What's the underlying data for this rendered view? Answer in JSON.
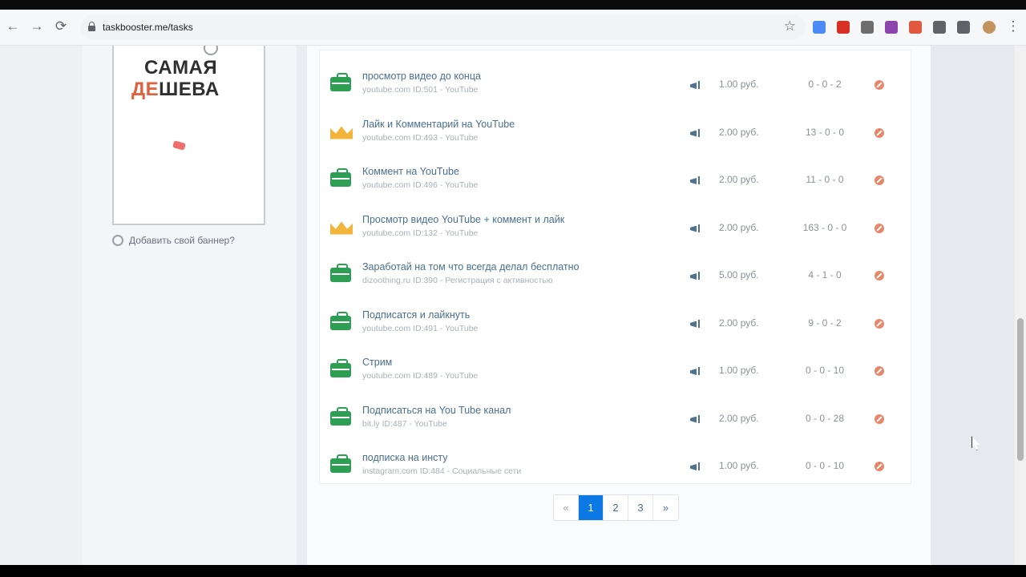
{
  "browser": {
    "url": "taskbooster.me/tasks",
    "back_glyph": "←",
    "forward_glyph": "→",
    "reload_glyph": "⟳",
    "star_glyph": "☆",
    "menu_glyph": "⋮",
    "extensions": [
      {
        "name": "ext-1-icon",
        "color": "#4c8bf5"
      },
      {
        "name": "ext-2-icon",
        "color": "#d93025"
      },
      {
        "name": "ext-3-icon",
        "color": "#6d6d6d"
      },
      {
        "name": "ext-4-icon",
        "color": "#8e44ad"
      },
      {
        "name": "ext-5-icon",
        "color": "#e2583e"
      },
      {
        "name": "ext-6-icon",
        "color": "#5f6368"
      },
      {
        "name": "extensions-puzzle-icon",
        "color": "#5f6368"
      },
      {
        "name": "profile-avatar-icon",
        "color": "#c2935f"
      }
    ]
  },
  "sidebar": {
    "banner_line1": "САМАЯ",
    "banner_line2_red": "ДЕ",
    "banner_line2_rest": "ШЕВА",
    "add_banner_label": "Добавить свой баннер?"
  },
  "tasks": [
    {
      "icon": "briefcase",
      "title": "просмотр видео до конца",
      "meta": "youtube.com ID:501 - YouTube",
      "price": "1.00 руб.",
      "counts": "0 - 0 - 2"
    },
    {
      "icon": "crown",
      "title": "Лайк и Комментарий на YouTube",
      "meta": "youtube.com ID:493 - YouTube",
      "price": "2.00 руб.",
      "counts": "13 - 0 - 0"
    },
    {
      "icon": "briefcase",
      "title": "Коммент на YouTube",
      "meta": "youtube.com ID:496 - YouTube",
      "price": "2.00 руб.",
      "counts": "11 - 0 - 0"
    },
    {
      "icon": "crown",
      "title": "Просмотр видео YouTube + коммент и лайк",
      "meta": "youtube.com ID:132 - YouTube",
      "price": "2.00 руб.",
      "counts": "163 - 0 - 0"
    },
    {
      "icon": "briefcase",
      "title": "Заработай на том что всегда делал бесплатно",
      "meta": "dizoothing.ru ID:390 - Регистрация с активностью",
      "price": "5.00 руб.",
      "counts": "4 - 1 - 0"
    },
    {
      "icon": "briefcase",
      "title": "Подписатся и лайкнуть",
      "meta": "youtube.com ID:491 - YouTube",
      "price": "2.00 руб.",
      "counts": "9 - 0 - 2"
    },
    {
      "icon": "briefcase",
      "title": "Стрим",
      "meta": "youtube.com ID:489 - YouTube",
      "price": "1.00 руб.",
      "counts": "0 - 0 - 10"
    },
    {
      "icon": "briefcase",
      "title": "Подписаться на You Tube канал",
      "meta": "bit.ly ID:487 - YouTube",
      "price": "2.00 руб.",
      "counts": "0 - 0 - 28"
    },
    {
      "icon": "briefcase",
      "title": "подписка на инсту",
      "meta": "instagram.com ID:484 - Социальные сети",
      "price": "1.00 руб.",
      "counts": "0 - 0 - 10"
    }
  ],
  "pagination": {
    "prev": "«",
    "pages": [
      "1",
      "2",
      "3"
    ],
    "active": "1",
    "next": "»"
  }
}
